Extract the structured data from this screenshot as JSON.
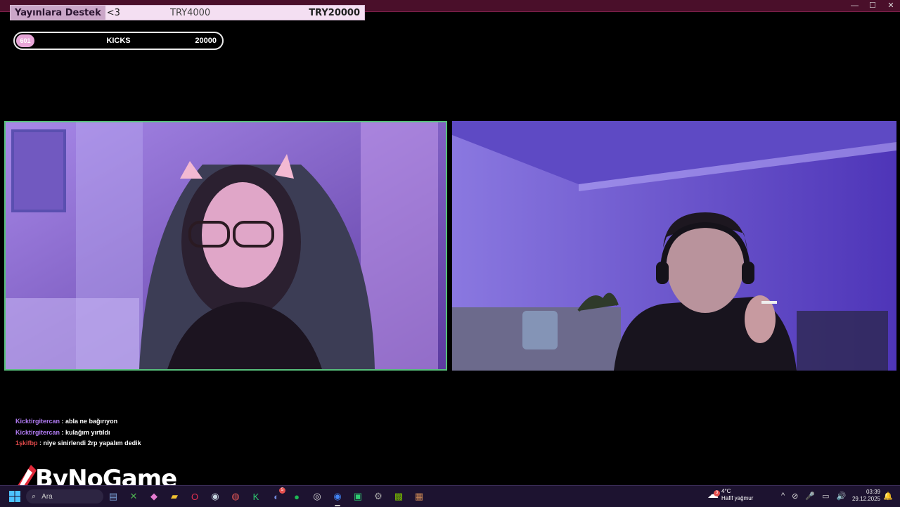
{
  "window": {
    "controls": [
      "—",
      "☐",
      "✕"
    ]
  },
  "donation_bar": {
    "label": "Yayınlara Destek",
    "heart": "<3",
    "current": "TRY4000",
    "goal": "TRY20000"
  },
  "kicks_bar": {
    "count": "601",
    "name": "KICKS",
    "total": "20000",
    "progress_fraction": 0.03
  },
  "cameras": [
    {
      "name": "left-webcam",
      "border_color": "#57c07b"
    },
    {
      "name": "right-webcam"
    }
  ],
  "chat": [
    {
      "user": "Kicktirgitercan",
      "message": ": abla ne bağırıyon",
      "user_color": "#b27cf5"
    },
    {
      "user": "Kicktirgitercan",
      "message": ": kulağım yırtıldı",
      "user_color": "#b27cf5"
    },
    {
      "user": "1şkifbp",
      "message": ": niye sinirlendi 2rp yapalım dedik",
      "user_color": "#e24a4a"
    }
  ],
  "logo": {
    "text": "ByNoGame"
  },
  "taskbar": {
    "search_placeholder": "Ara",
    "icons": [
      {
        "name": "widgets-icon",
        "glyph": "▤",
        "color": "#7aa0d8"
      },
      {
        "name": "xbox-icon",
        "glyph": "✕",
        "color": "#4caf50"
      },
      {
        "name": "copilot-icon",
        "glyph": "◆",
        "color": "#e57bd0"
      },
      {
        "name": "file-explorer-icon",
        "glyph": "▰",
        "color": "#f2c230"
      },
      {
        "name": "opera-icon",
        "glyph": "O",
        "color": "#e03050"
      },
      {
        "name": "steam-icon",
        "glyph": "◉",
        "color": "#c6d4df"
      },
      {
        "name": "davinci-icon",
        "glyph": "◍",
        "color": "#d55"
      },
      {
        "name": "kick-icon",
        "glyph": "K",
        "color": "#2ecc71"
      },
      {
        "name": "discord-icon",
        "glyph": "◐",
        "color": "#7289da",
        "badge": "5"
      },
      {
        "name": "spotify-icon",
        "glyph": "●",
        "color": "#1db954"
      },
      {
        "name": "obs-icon",
        "glyph": "◎",
        "color": "#ddd"
      },
      {
        "name": "chrome-icon",
        "glyph": "◉",
        "color": "#4285f4",
        "active": true
      },
      {
        "name": "app-icon",
        "glyph": "▣",
        "color": "#2ecc71"
      },
      {
        "name": "settings-icon",
        "glyph": "⚙",
        "color": "#aaa"
      },
      {
        "name": "nvidia-icon",
        "glyph": "▩",
        "color": "#76b900"
      },
      {
        "name": "winrar-icon",
        "glyph": "▦",
        "color": "#c85"
      }
    ],
    "weather": {
      "temp": "4°C",
      "desc": "Hafif yağmur",
      "badge": "3"
    },
    "tray_icons": [
      "^",
      "⊘",
      "🎤",
      "▭",
      "🔊"
    ],
    "clock": {
      "time": "03:39",
      "date": "29.12.2025"
    }
  }
}
